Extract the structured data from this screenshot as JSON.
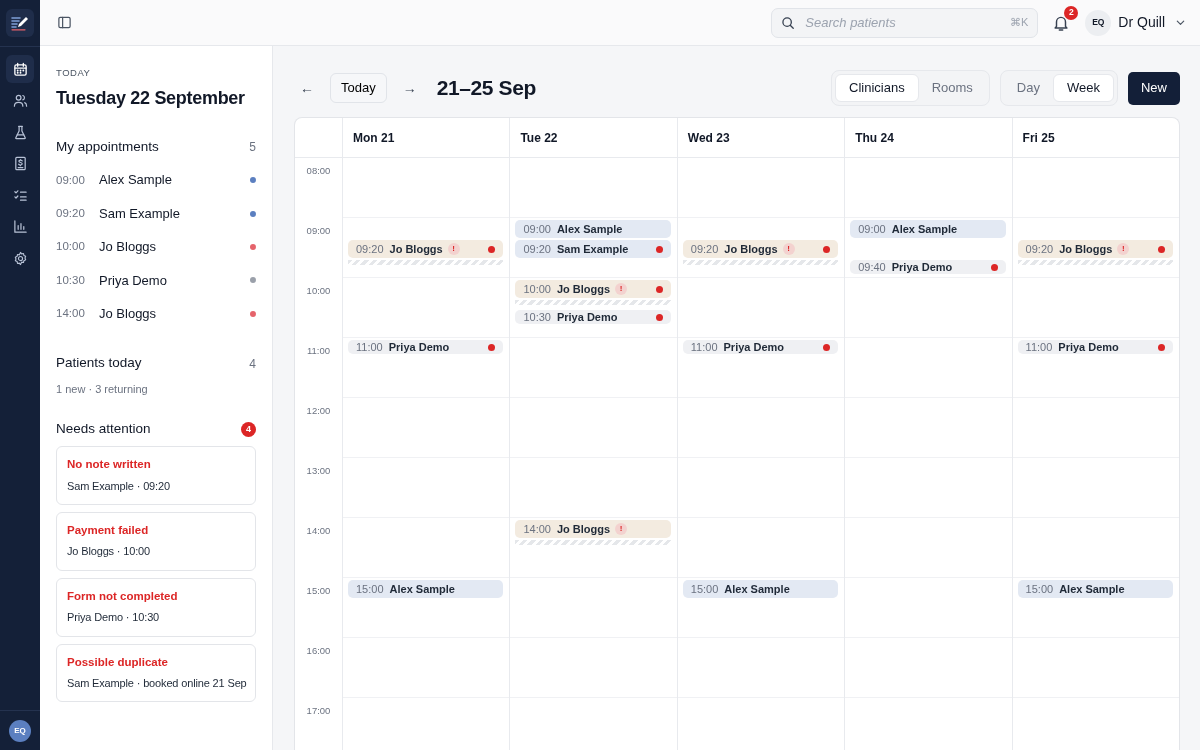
{
  "rail": {
    "items": [
      {
        "selected": true
      },
      {
        "selected": false
      },
      {
        "selected": false
      },
      {
        "selected": false
      },
      {
        "selected": false
      },
      {
        "selected": false
      },
      {
        "selected": false
      }
    ],
    "avatar": "EQ"
  },
  "topbar": {
    "search": {
      "placeholder": "Search patients",
      "shortcut": "⌘K"
    },
    "notifications": "2",
    "user": {
      "initials": "EQ",
      "name": "Dr Quill"
    }
  },
  "today": {
    "label": "TODAY",
    "date": "Tuesday 22 September"
  },
  "my_appointments": {
    "title": "My appointments",
    "count": "5",
    "items": [
      {
        "time": "09:00",
        "name": "Alex Sample",
        "color": "#5b7fc0"
      },
      {
        "time": "09:20",
        "name": "Sam Example",
        "color": "#5b7fc0"
      },
      {
        "time": "10:00",
        "name": "Jo Bloggs",
        "color": "#e5636b"
      },
      {
        "time": "10:30",
        "name": "Priya Demo",
        "color": "#9aa0aa"
      },
      {
        "time": "14:00",
        "name": "Jo Bloggs",
        "color": "#e5636b"
      }
    ]
  },
  "patients_today": {
    "title": "Patients today",
    "count": "4",
    "summary": "1 new · 3 returning"
  },
  "needs_attention": {
    "title": "Needs attention",
    "count": "4",
    "items": [
      {
        "title": "No note written",
        "detail": "Sam Example · 09:20"
      },
      {
        "title": "Payment failed",
        "detail": "Jo Bloggs · 10:00"
      },
      {
        "title": "Form not completed",
        "detail": "Priya Demo · 10:30"
      },
      {
        "title": "Possible duplicate",
        "detail": "Sam Example · booked online 21 Sep"
      }
    ]
  },
  "toolbar": {
    "prev": "←",
    "today": "Today",
    "next": "→",
    "range": "21–25 Sep",
    "group_toggle": [
      {
        "label": "Clinicians",
        "selected": true
      },
      {
        "label": "Rooms",
        "selected": false
      }
    ],
    "view_toggle": [
      {
        "label": "Day",
        "selected": false
      },
      {
        "label": "Week",
        "selected": true
      }
    ],
    "new_button": "New"
  },
  "calendar": {
    "hours": [
      "08:00",
      "09:00",
      "10:00",
      "11:00",
      "12:00",
      "13:00",
      "14:00",
      "15:00",
      "16:00",
      "17:00"
    ],
    "days": [
      {
        "label": "Mon 21",
        "events": [
          {
            "time": "09:20",
            "name": "Jo Bloggs",
            "kind": "flagged",
            "flag": "!",
            "dot": true
          },
          {
            "time": "11:00",
            "name": "Priya Demo",
            "kind": "tentative",
            "dot": true
          },
          {
            "time": "15:00",
            "name": "Alex Sample",
            "kind": "booked",
            "dot": false
          }
        ]
      },
      {
        "label": "Tue 22",
        "events": [
          {
            "time": "09:00",
            "name": "Alex Sample",
            "kind": "booked",
            "dot": false
          },
          {
            "time": "09:20",
            "name": "Sam Example",
            "kind": "booked",
            "dot": true
          },
          {
            "time": "10:00",
            "name": "Jo Bloggs",
            "kind": "flagged",
            "flag": "!",
            "dot": true
          },
          {
            "time": "10:30",
            "name": "Priya Demo",
            "kind": "tentative",
            "dot": true
          },
          {
            "time": "14:00",
            "name": "Jo Bloggs",
            "kind": "flagged",
            "flag": "!",
            "dot": false
          }
        ]
      },
      {
        "label": "Wed 23",
        "events": [
          {
            "time": "09:20",
            "name": "Jo Bloggs",
            "kind": "flagged",
            "flag": "!",
            "dot": true
          },
          {
            "time": "11:00",
            "name": "Priya Demo",
            "kind": "tentative",
            "dot": true
          },
          {
            "time": "15:00",
            "name": "Alex Sample",
            "kind": "booked",
            "dot": false
          }
        ]
      },
      {
        "label": "Thu 24",
        "events": [
          {
            "time": "09:00",
            "name": "Alex Sample",
            "kind": "booked",
            "dot": false
          },
          {
            "time": "09:40",
            "name": "Priya Demo",
            "kind": "tentative",
            "dot": true
          }
        ]
      },
      {
        "label": "Fri 25",
        "events": [
          {
            "time": "09:20",
            "name": "Jo Bloggs",
            "kind": "flagged",
            "flag": "!",
            "dot": true
          },
          {
            "time": "11:00",
            "name": "Priya Demo",
            "kind": "tentative",
            "dot": true
          },
          {
            "time": "15:00",
            "name": "Alex Sample",
            "kind": "booked",
            "dot": false
          }
        ]
      }
    ]
  }
}
